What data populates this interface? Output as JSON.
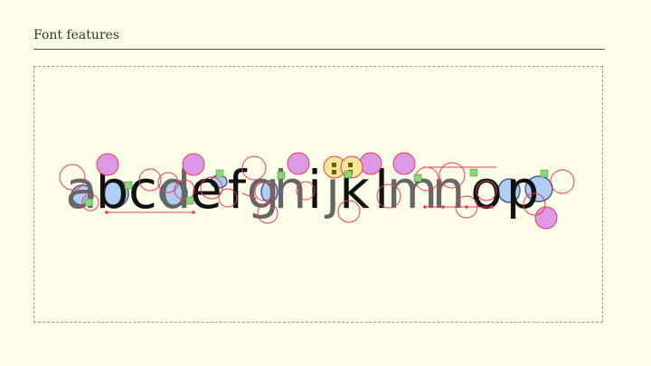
{
  "header": {
    "title": "Font features"
  },
  "specimen": {
    "glyphs": [
      "a",
      "b",
      "c",
      "d",
      "e",
      "f",
      "g",
      "h",
      "i",
      "j",
      "k",
      "l",
      "m",
      "n",
      "o",
      "p"
    ],
    "colors": {
      "ink": "#111111",
      "ink_alt": "#666666",
      "counter": "#a8c8f5",
      "counter_stroke": "#334c88",
      "marker_red": "#e23c5c",
      "marker_magenta": "#dd99e6",
      "marker_yellow": "#f7e898",
      "marker_green": "#8cd67a",
      "background": "#fefee9"
    }
  }
}
